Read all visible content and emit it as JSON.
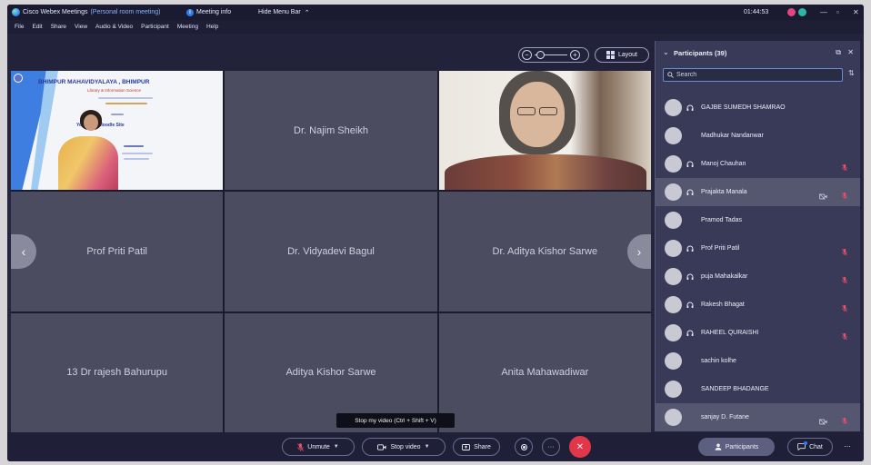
{
  "theme": {
    "accent": "#2f7bf5",
    "end_call": "#e0374a",
    "muted": "#e8506a",
    "tile_bg": "#4b4c60",
    "panel_bg": "#393a58"
  },
  "window": {
    "title": "Cisco Webex Meetings",
    "title_note": "(Personal room meeting)",
    "meeting_info": "Meeting info",
    "hide_menu": "Hide Menu Bar",
    "timer": "01:44:53"
  },
  "menu": [
    "File",
    "Edit",
    "Share",
    "View",
    "Audio & Video",
    "Participant",
    "Meeting",
    "Help"
  ],
  "view_controls": {
    "layout_label": "Layout"
  },
  "share": {
    "slide_title": "BHIMPUR MAHAVIDYALAYA , BHIMPUR",
    "slide_subtitle": "Library & Information Science",
    "slide_topic": "Your Own Moodle Site"
  },
  "tiles": {
    "names": [
      "Dr. Najim Sheikh",
      "Prof Priti Patil",
      "Dr. Vidyadevi Bagul",
      "Dr. Aditya Kishor Sarwe",
      "13 Dr rajesh Bahurupu",
      "Aditya Kishor Sarwe",
      "Anita Mahawadiwar"
    ]
  },
  "tooltip": "Stop my video (Ctrl + Shift + V)",
  "toolbar": {
    "unmute": "Unmute",
    "stop_video": "Stop video",
    "share": "Share",
    "participants": "Participants",
    "chat": "Chat"
  },
  "participants": {
    "title": "Participants (39)",
    "search_placeholder": "Search",
    "list": [
      {
        "name": "GAJBE SUMEDH SHAMRAO",
        "device": true,
        "muted": false,
        "video_off": false,
        "selected": false
      },
      {
        "name": "Madhukar Nandanwar",
        "device": false,
        "muted": false,
        "video_off": false,
        "selected": false
      },
      {
        "name": "Manoj Chauhan",
        "device": true,
        "muted": true,
        "video_off": false,
        "selected": false
      },
      {
        "name": "Prajakta Manala",
        "device": true,
        "muted": true,
        "video_off": true,
        "selected": true
      },
      {
        "name": "Pramod Tadas",
        "device": false,
        "muted": false,
        "video_off": false,
        "selected": false
      },
      {
        "name": "Prof Priti Patil",
        "device": true,
        "muted": true,
        "video_off": false,
        "selected": false
      },
      {
        "name": "puja Mahakalkar",
        "device": true,
        "muted": true,
        "video_off": false,
        "selected": false
      },
      {
        "name": "Rakesh Bhagat",
        "device": true,
        "muted": true,
        "video_off": false,
        "selected": false
      },
      {
        "name": "RAHEEL QURAISHI",
        "device": true,
        "muted": true,
        "video_off": false,
        "selected": false
      },
      {
        "name": "sachin kolhe",
        "device": false,
        "muted": false,
        "video_off": false,
        "selected": false
      },
      {
        "name": "SANDEEP BHADANGE",
        "device": false,
        "muted": false,
        "video_off": false,
        "selected": false
      },
      {
        "name": "sanjay D. Futane",
        "device": false,
        "muted": true,
        "video_off": true,
        "selected": true
      }
    ]
  }
}
